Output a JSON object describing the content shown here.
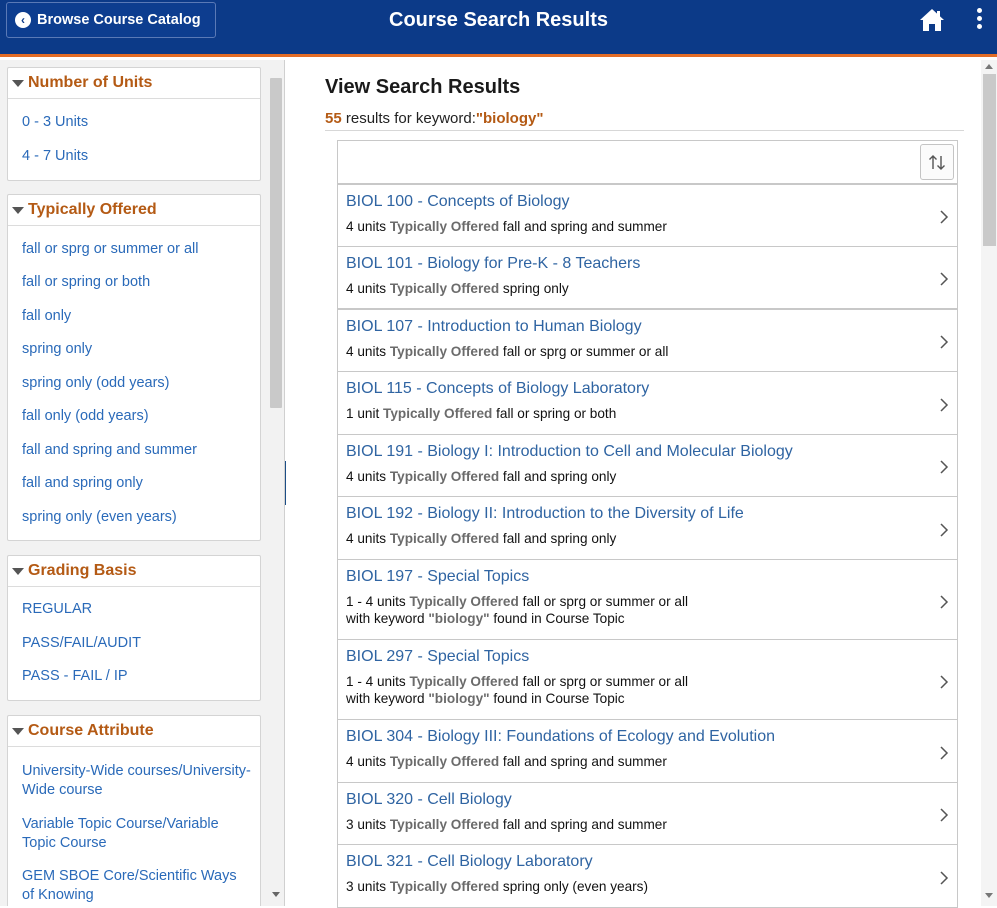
{
  "header": {
    "back_label": "Browse Course Catalog",
    "title": "Course Search Results",
    "home_icon": "home-icon",
    "menu_icon": "kebab-menu-icon"
  },
  "colors": {
    "header_bg": "#0c3a88",
    "accent_orange": "#e36c26",
    "facet_heading": "#b45a14",
    "link_blue": "#2a6ab9",
    "course_title_blue": "#2f64a2"
  },
  "facets": [
    {
      "heading": "Number of Units",
      "items": [
        "0 - 3 Units",
        "4 - 7 Units"
      ]
    },
    {
      "heading": "Typically Offered",
      "items": [
        "fall or sprg or summer or all",
        "fall or spring or both",
        "fall only",
        "spring only",
        "spring only (odd years)",
        "fall only (odd years)",
        "fall and spring and summer",
        "fall and spring only",
        "spring only (even years)"
      ]
    },
    {
      "heading": "Grading Basis",
      "items": [
        "REGULAR",
        "PASS/FAIL/AUDIT",
        "PASS - FAIL / IP"
      ]
    },
    {
      "heading": "Course Attribute",
      "items": [
        "University-Wide courses/University-Wide course",
        "Variable Topic Course/Variable Topic Course",
        "GEM SBOE Core/Scientific Ways of Knowing"
      ]
    }
  ],
  "results": {
    "heading": "View Search Results",
    "count": "55",
    "count_text": " results for keyword:",
    "keyword": "\"biology\"",
    "sort_icon": "sort-arrows-icon",
    "offered_label": "Typically Offered",
    "keyword_prefix": "with keyword ",
    "keyword_suffix": " found in Course Topic",
    "courses": [
      {
        "title": "BIOL 100 - Concepts of Biology",
        "units": "4 units",
        "offered": "fall and spring and summer"
      },
      {
        "title": "BIOL 101 - Biology for Pre-K - 8 Teachers",
        "units": "4 units",
        "offered": "spring only"
      },
      {
        "title": "BIOL 107 - Introduction to Human Biology",
        "units": "4 units",
        "offered": "fall or sprg or summer or all"
      },
      {
        "title": "BIOL 115 - Concepts of Biology Laboratory",
        "units": "1 unit",
        "offered": "fall or spring or both"
      },
      {
        "title": "BIOL 191 - Biology I: Introduction to Cell and Molecular Biology",
        "units": "4 units",
        "offered": "fall and spring only"
      },
      {
        "title": "BIOL 192 - Biology II: Introduction to the Diversity of Life",
        "units": "4 units",
        "offered": "fall and spring only"
      },
      {
        "title": "BIOL 197 - Special Topics",
        "units": "1 - 4 units",
        "offered": "fall or sprg or summer or all",
        "keyword": "\"biology\""
      },
      {
        "title": "BIOL 297 - Special Topics",
        "units": "1 - 4 units",
        "offered": "fall or sprg or summer or all",
        "keyword": "\"biology\""
      },
      {
        "title": "BIOL 304 - Biology III: Foundations of Ecology and Evolution",
        "units": "4 units",
        "offered": "fall and spring and summer"
      },
      {
        "title": "BIOL 320 - Cell Biology",
        "units": "3 units",
        "offered": "fall and spring and summer"
      },
      {
        "title": "BIOL 321 - Cell Biology Laboratory",
        "units": "3 units",
        "offered": "spring only (even years)"
      }
    ]
  }
}
